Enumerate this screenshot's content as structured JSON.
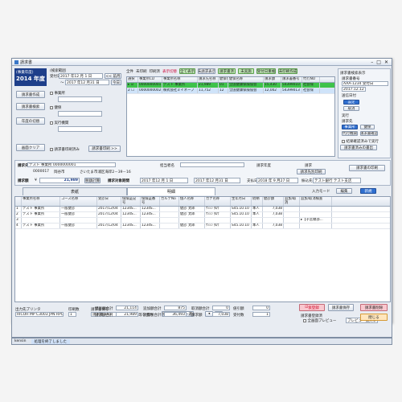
{
  "window": {
    "title": "請求書",
    "min": "–",
    "max": "□",
    "close": "✕"
  },
  "left": {
    "fiscal_label": "(事業年度)",
    "fiscal_year": "2014 年度",
    "search_label": "(検索範囲",
    "search_opt": "(検索対象)",
    "b_invoice": "請求書作成",
    "b_search": "請求書検索",
    "b_annual": "年度の切替",
    "b_clear": "画面クリア",
    "d_from_label": "受付日",
    "d_from": "2017 年12 月 1 日",
    "d_to_label": "～",
    "d_to": "2017 年12 月31 日",
    "today": "今日",
    "prev_month": "<< 前月",
    "next_month": "翌月 >>",
    "office": "事業所",
    "health": "健保",
    "exec": "実行機関",
    "chk_print": "請求書印刷済み",
    "print_btn": "請求書印刷 >>"
  },
  "filter": {
    "all": "全件",
    "unprinted": "未印刷",
    "printed": "印刷済",
    "display": "表示切替",
    "b_all": "全て表示",
    "b1": "未請求表示",
    "b2": "請求書済",
    "b3": "未実施",
    "b4": "受付日重複",
    "b5": "未印刷作成"
  },
  "list_headers": [
    "選択",
    "事業所CD",
    "事業所名称",
    "請求先名称",
    "健保CD",
    "健保名称",
    "請求額",
    "請求書番号",
    "代行NO"
  ],
  "list_rows": [
    {
      "c": [
        "▸ ☑",
        "0000000001",
        "テスト 事業所",
        "21,989",
        "01",
        "全国健康保険協会",
        "15,430",
        "54399010",
        "社会保"
      ]
    },
    {
      "c": [
        "2 ☐",
        "0000000002",
        "株式会社ミイネーブ",
        "11,752",
        "12",
        "全国健康保険協会",
        "12,002",
        "54399013",
        "社会保"
      ]
    }
  ],
  "right": {
    "title": "請求書検索表示",
    "no_label": "請求書番号",
    "no_val": "AAA-1234 受付日",
    "date_val": "2017.12.12",
    "send": "送信日付",
    "b_set": "設定",
    "b_cancel": "取消",
    "exe": "実行",
    "b_office": "事業所",
    "b_health": "健保",
    "b_agency": "代行機関",
    "b_cal": "請求書確定",
    "target": "請求先",
    "chk_result": "結果確認済みで実行",
    "print_all": "請求書発行 >>",
    "stamp": "請求書済みの書出"
  },
  "mid": {
    "dest_label": "請求先",
    "dest_val": "テスト 事業所  0000000001",
    "sub_val": "0000017",
    "place": "岡谷市",
    "addr": "さいたま市浦区海岸2－39－16",
    "stamp_lbl": "担当者名",
    "stamp_val": "",
    "rep_lbl": "請求年度",
    "rep": "請求",
    "proof": "請求先別印刷",
    "print_inv": "請求書の印刷",
    "amount_lbl": "請求額",
    "yen": "¥",
    "amount": "21,989",
    "tax_btn": "税額計算",
    "tgt_period": "請求対象期間",
    "p_from": "2017 年12 月 1 日",
    "p_to": "2017 年12 月31 日",
    "pay_day_lbl": "支払日",
    "pay_day": "2018 年 9 月27 日",
    "pay_method_lbl": "振込先",
    "pay_method": "テスト銀行 テスト支店"
  },
  "tabs": {
    "t1": "表紙",
    "t2": "明細"
  },
  "detail": {
    "input_mode": "入力モード",
    "b_edit": "編集",
    "b_new": "新規",
    "headers": [
      "",
      "事業所名称",
      "コース名称",
      "受診日",
      "保険証記号",
      "保険証番号",
      "カルテNo",
      "個人名称",
      "カナ名称",
      "生年月日",
      "続柄",
      "健診額",
      "追加/取消",
      "追加/取消検査"
    ],
    "rows": [
      [
        "1",
        "テスト 事業所",
        "一般健診",
        "2017/12/04",
        "1234S...",
        "1234S...",
        "",
        "健診 太郎",
        "ｹﾝｼﾝ ﾀﾛｳ",
        "S45.10.10",
        "本人",
        "7,038",
        "",
        ""
      ],
      [
        "2",
        "テスト 事業所",
        "一般健診",
        "2017/12/04",
        "1234S...",
        "1234S...",
        "",
        "健診 太郎",
        "ｹﾝｼﾝ ﾀﾛｳ",
        "S45.10.10",
        "本人",
        "7,038",
        "",
        ""
      ],
      [
        "3",
        "",
        "",
        "",
        "",
        "",
        "",
        "",
        "",
        "",
        "",
        "",
        "",
        "▸【子宮頸部..."
      ],
      [
        "4",
        "テスト 事業所",
        "一般健診",
        "2017/12/04",
        "1234S...",
        "1234S...",
        "",
        "健診 太郎",
        "ｹﾝｼﾝ ﾀﾛｳ",
        "S45.10.10",
        "本人",
        "7,038",
        "",
        ""
      ]
    ]
  },
  "bottom": {
    "b1": "行挿入",
    "b2": "表下行挿入",
    "b3": "受診者追加",
    "b4": "行削除",
    "printer_lbl": "出力先プリンタ",
    "printer": "RICOH MP C3003 JPN RPCS",
    "copies_lbl": "印刷数",
    "copies": "1",
    "file_lbl": "請求書保存",
    "file": "請求書.xlsx",
    "chk_print_cover": "表紙等を出力",
    "detail_layout": "明細のレイアウト選択",
    "tot1_lbl": "健診額合計",
    "tot1": "21,114",
    "tot2_lbl": "追加額合計",
    "tot2": "875",
    "tot3_lbl": "取消額合計",
    "tot3": "0",
    "tot4_lbl": "値引額",
    "tot4": "0",
    "tot5_lbl": "請求額合計",
    "tot5": "21,989",
    "tot6_lbl": "消費税合計",
    "tot6": "36,493",
    "tot7_lbl": "請求額",
    "tot7": "7,038",
    "tot8_lbl": "受付数",
    "tot8": "1",
    "kari": "仮登録",
    "save": "請求書保存",
    "del": "請求書削除",
    "reg": "請求書登録済",
    "close": "閉じる",
    "preview": "全画面プレビュー",
    "zoom": "プレビュー拡大率 ▾"
  },
  "status": {
    "user": "kensin",
    "msg": "処理を終了しました"
  }
}
